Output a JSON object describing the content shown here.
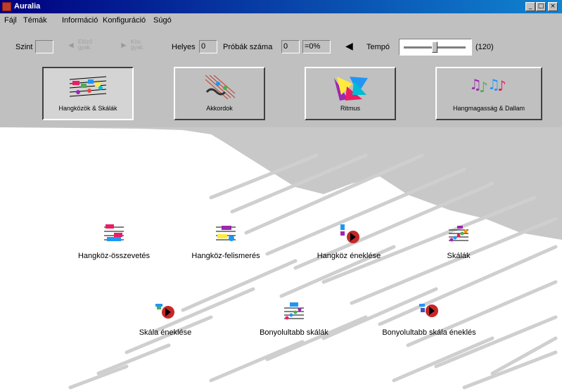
{
  "window": {
    "title": "Auralia"
  },
  "menu": [
    "Fájl",
    "Témák",
    "Információ",
    "Konfiguráció",
    "Súgó"
  ],
  "toolbar": {
    "szint_label": "Szint",
    "szint_value": "",
    "prev_label": "Előző gyak.",
    "next_label": "Köv. gyak.",
    "helyes_label": "Helyes",
    "helyes_value": "0",
    "probak_label": "Próbák száma",
    "probak_value": "0",
    "percent_value": "=0%",
    "tempo_label": "Tempó",
    "tempo_value": "(120)",
    "tempo_level": 0.5
  },
  "modes": [
    {
      "label": "Hangközök & Skálák",
      "icon": "intervals-scales-icon",
      "pressed": true
    },
    {
      "label": "Akkordok",
      "icon": "chords-icon",
      "pressed": false
    },
    {
      "label": "Ritmus",
      "icon": "rhythm-icon",
      "pressed": false
    },
    {
      "label": "Hangmagasság & Dallam",
      "icon": "pitch-melody-icon",
      "pressed": false
    }
  ],
  "exercises": [
    {
      "label": "Hangköz-összevetés",
      "icon": "interval-compare-icon"
    },
    {
      "label": "Hangköz-felismerés",
      "icon": "interval-recognition-icon"
    },
    {
      "label": "Hangköz éneklése",
      "icon": "interval-singing-icon"
    },
    {
      "label": "Skálák",
      "icon": "scales-icon"
    },
    {
      "label": "Skála éneklése",
      "icon": "scale-singing-icon"
    },
    {
      "label": "Bonyolultabb skálák",
      "icon": "advanced-scales-icon"
    },
    {
      "label": "Bonyolultabb skála éneklés",
      "icon": "advanced-scale-singing-icon"
    }
  ],
  "colors": {
    "titlebar_start": "#000080",
    "titlebar_end": "#1084d0",
    "face": "#c0c0c0",
    "canvas": "#ffffff"
  }
}
